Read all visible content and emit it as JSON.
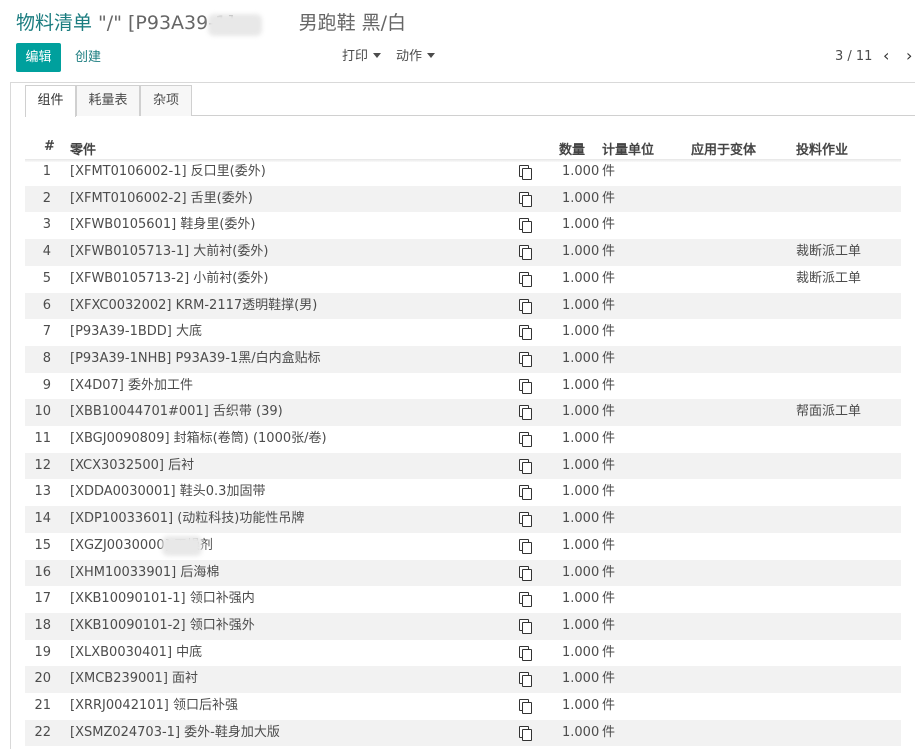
{
  "header": {
    "breadcrumb": "物料清单",
    "separator": " \"/\" ",
    "record_code": "[P93A39-1] ",
    "record_name": "男跑鞋 黑/白"
  },
  "toolbar": {
    "edit_label": "编辑",
    "create_label": "创建",
    "print_label": "打印",
    "action_label": "动作",
    "pager": "3 / 11",
    "prev_icon": "‹",
    "next_icon": "›"
  },
  "tabs": [
    "组件",
    "耗量表",
    "杂项"
  ],
  "columns": {
    "num": "#",
    "part": "零件",
    "qty": "数量",
    "uom": "计量单位",
    "variant": "应用于变体",
    "operation": "投料作业"
  },
  "rows": [
    {
      "n": "1",
      "part": "[XFMT0106002-1] 反口里(委外)",
      "qty": "1.000",
      "uom": "件",
      "op": ""
    },
    {
      "n": "2",
      "part": "[XFMT0106002-2] 舌里(委外)",
      "qty": "1.000",
      "uom": "件",
      "op": ""
    },
    {
      "n": "3",
      "part": "[XFWB0105601] 鞋身里(委外)",
      "qty": "1.000",
      "uom": "件",
      "op": ""
    },
    {
      "n": "4",
      "part": "[XFWB0105713-1] 大前衬(委外)",
      "qty": "1.000",
      "uom": "件",
      "op": "裁断派工单"
    },
    {
      "n": "5",
      "part": "[XFWB0105713-2] 小前衬(委外)",
      "qty": "1.000",
      "uom": "件",
      "op": "裁断派工单"
    },
    {
      "n": "6",
      "part": "[XFXC0032002] KRM-2117透明鞋撑(男)",
      "qty": "1.000",
      "uom": "件",
      "op": ""
    },
    {
      "n": "7",
      "part": "[P93A39-1BDD] 大底",
      "qty": "1.000",
      "uom": "件",
      "op": ""
    },
    {
      "n": "8",
      "part": "[P93A39-1NHB] P93A39-1黑/白内盒贴标",
      "qty": "1.000",
      "uom": "件",
      "op": ""
    },
    {
      "n": "9",
      "part": "[X4D07] 委外加工件",
      "qty": "1.000",
      "uom": "件",
      "op": ""
    },
    {
      "n": "10",
      "part": "[XBB10044701#001] 舌织带 (39)",
      "qty": "1.000",
      "uom": "件",
      "op": "帮面派工单"
    },
    {
      "n": "11",
      "part": "[XBGJ0090809] 封箱标(卷筒) (1000张/卷)",
      "qty": "1.000",
      "uom": "件",
      "op": ""
    },
    {
      "n": "12",
      "part": "[XCX3032500] 后衬",
      "qty": "1.000",
      "uom": "件",
      "op": ""
    },
    {
      "n": "13",
      "part": "[XDDA0030001] 鞋头0.3加固带",
      "qty": "1.000",
      "uom": "件",
      "op": ""
    },
    {
      "n": "14",
      "part": "[XDP10033601] (动粒科技)功能性吊牌",
      "qty": "1.000",
      "uom": "件",
      "op": ""
    },
    {
      "n": "15",
      "part": "[XGZJ0030000]      干燥剂",
      "qty": "1.000",
      "uom": "件",
      "op": ""
    },
    {
      "n": "16",
      "part": "[XHM10033901] 后海棉",
      "qty": "1.000",
      "uom": "件",
      "op": ""
    },
    {
      "n": "17",
      "part": "[XKB10090101-1] 领口补强内",
      "qty": "1.000",
      "uom": "件",
      "op": ""
    },
    {
      "n": "18",
      "part": "[XKB10090101-2] 领口补强外",
      "qty": "1.000",
      "uom": "件",
      "op": ""
    },
    {
      "n": "19",
      "part": "[XLXB0030401] 中底",
      "qty": "1.000",
      "uom": "件",
      "op": ""
    },
    {
      "n": "20",
      "part": "[XMCB239001] 面衬",
      "qty": "1.000",
      "uom": "件",
      "op": ""
    },
    {
      "n": "21",
      "part": "[XRRJ0042101] 领口后补强",
      "qty": "1.000",
      "uom": "件",
      "op": ""
    },
    {
      "n": "22",
      "part": "[XSMZ024703-1] 委外-鞋身加大版",
      "qty": "1.000",
      "uom": "件",
      "op": ""
    }
  ]
}
